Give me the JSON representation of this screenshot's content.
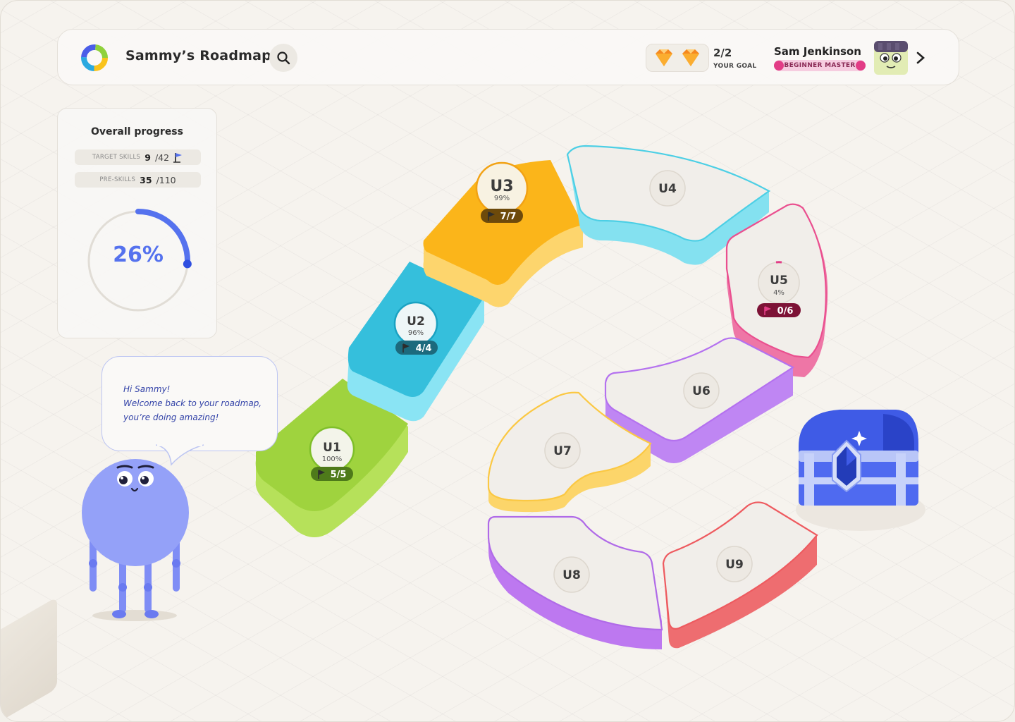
{
  "header": {
    "title": "Sammy’s Roadmap",
    "goal": {
      "count": "2/2",
      "label": "YOUR GOAL"
    },
    "user": {
      "name": "Sam Jenkinson",
      "badge": "BEGINNER MASTER"
    }
  },
  "progress": {
    "title": "Overall progress",
    "target_skills": {
      "label": "TARGET SKILLS",
      "value": "9",
      "total": "/42"
    },
    "pre_skills": {
      "label": "PRE-SKILLS",
      "value": "35",
      "total": "/110"
    },
    "percent": 26,
    "percent_label": "26%"
  },
  "bubble": {
    "line1": "Hi Sammy!",
    "line2": "Welcome back to your roadmap,",
    "line3": "you’re doing amazing!"
  },
  "units": [
    {
      "id": "U1",
      "pct": "100%",
      "skills": "5/5",
      "color": "#9fd33e"
    },
    {
      "id": "U2",
      "pct": "96%",
      "skills": "4/4",
      "color": "#35bfdc"
    },
    {
      "id": "U3",
      "pct": "99%",
      "skills": "7/7",
      "color": "#fbb51a"
    },
    {
      "id": "U4",
      "color": "#5fd6ea"
    },
    {
      "id": "U5",
      "pct": "4%",
      "skills": "0/6",
      "color": "#ea4f8f"
    },
    {
      "id": "U6",
      "color": "#b471ef"
    },
    {
      "id": "U7",
      "color": "#fbc843"
    },
    {
      "id": "U8",
      "color": "#b06ae8"
    },
    {
      "id": "U9",
      "color": "#ee5a5f"
    }
  ],
  "colors": {
    "accent": "#5572ee",
    "badge_pink": "#e23d86",
    "gem": "#f5881f",
    "chest": "#3f5be6"
  },
  "icons": [
    "logo-ring-icon",
    "search-icon",
    "gem-icon",
    "chevron-right-icon",
    "flag-icon",
    "treasure-chest-icon"
  ]
}
